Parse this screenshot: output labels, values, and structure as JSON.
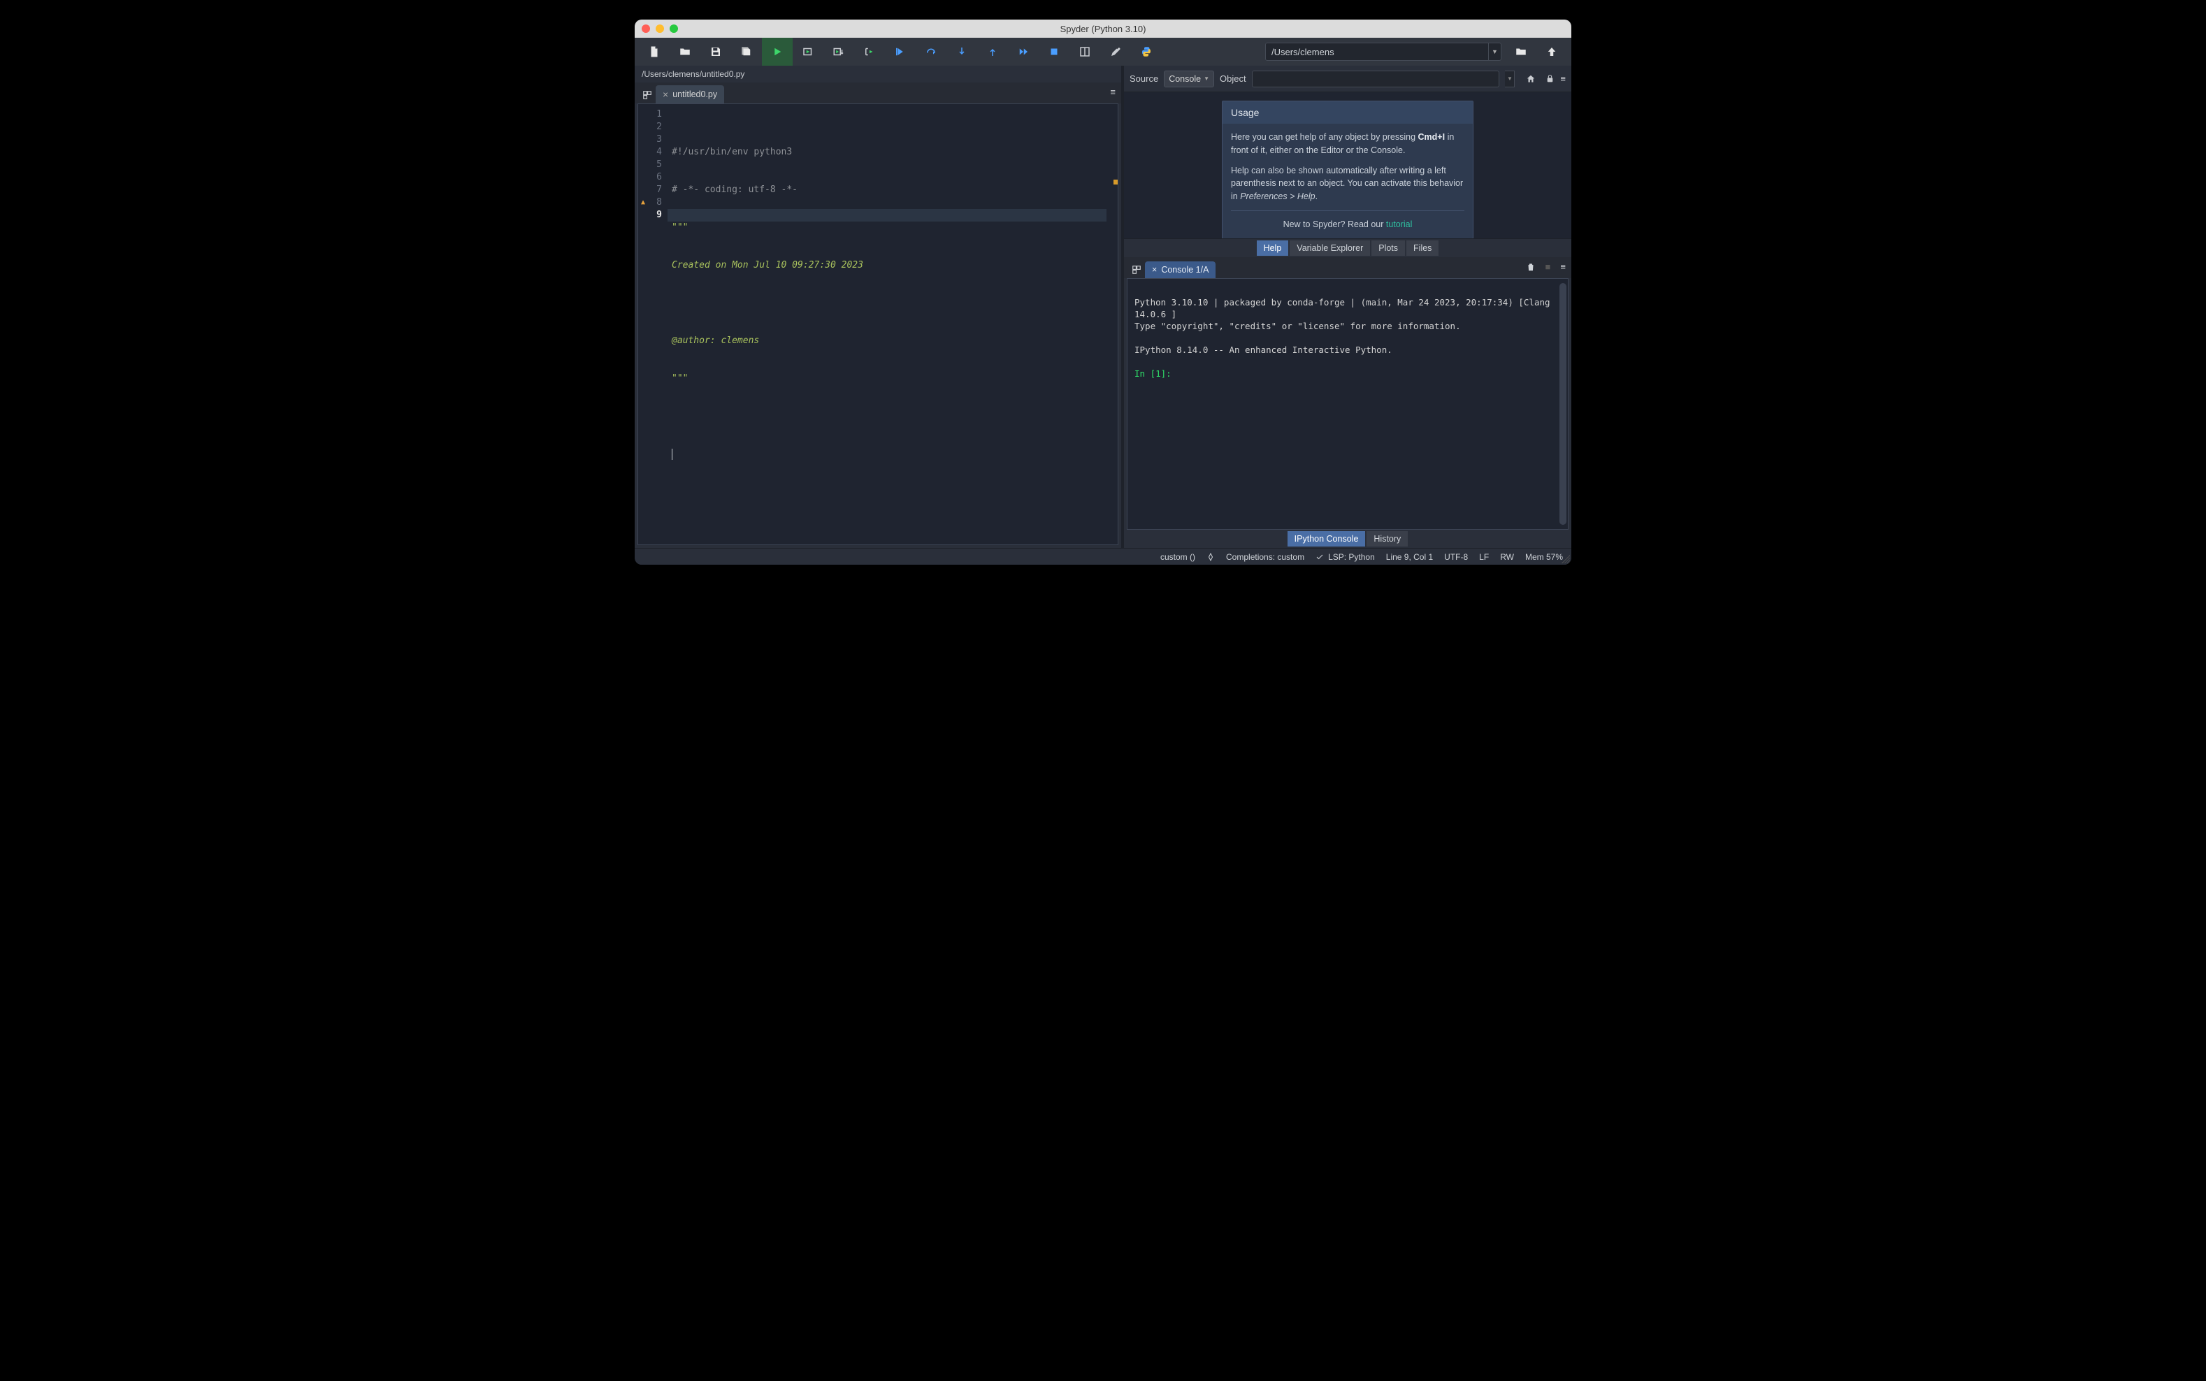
{
  "window": {
    "title": "Spyder (Python 3.10)"
  },
  "toolbar": {
    "cwd": "/Users/clemens"
  },
  "editor": {
    "path": "/Users/clemens/untitled0.py",
    "tab": "untitled0.py",
    "lines": {
      "l1": "#!/usr/bin/env python3",
      "l2": "# -*- coding: utf-8 -*-",
      "l3": "\"\"\"",
      "l4": "Created on Mon Jul 10 09:27:30 2023",
      "l5": "",
      "l6": "@author: clemens",
      "l7": "\"\"\"",
      "l8": "",
      "l9": ""
    },
    "gutter": {
      "n1": "1",
      "n2": "2",
      "n3": "3",
      "n4": "4",
      "n5": "5",
      "n6": "6",
      "n7": "7",
      "n8": "8",
      "n9": "9"
    }
  },
  "help": {
    "source_label": "Source",
    "source_value": "Console",
    "object_label": "Object",
    "card_title": "Usage",
    "p1a": "Here you can get help of any object by pressing ",
    "p1key": "Cmd+I",
    "p1b": " in front of it, either on the Editor or the Console.",
    "p2a": "Help can also be shown automatically after writing a left parenthesis next to an object. You can activate this behavior in ",
    "p2i": "Preferences > Help",
    "p2b": ".",
    "p3a": "New to Spyder? Read our ",
    "p3link": "tutorial"
  },
  "help_tabs": {
    "t1": "Help",
    "t2": "Variable Explorer",
    "t3": "Plots",
    "t4": "Files"
  },
  "console": {
    "tab": "Console 1/A",
    "line1": "Python 3.10.10 | packaged by conda-forge | (main, Mar 24 2023, 20:17:34) [Clang 14.0.6 ]",
    "line2": "Type \"copyright\", \"credits\" or \"license\" for more information.",
    "line3": "",
    "line4": "IPython 8.14.0 -- An enhanced Interactive Python.",
    "line5": "",
    "prompt": "In [1]:"
  },
  "console_tabs": {
    "t1": "IPython Console",
    "t2": "History"
  },
  "status": {
    "interp": "custom ()",
    "completions": "Completions: custom",
    "lsp": "LSP: Python",
    "cursor": "Line 9, Col 1",
    "encoding": "UTF-8",
    "eol": "LF",
    "perm": "RW",
    "mem": "Mem 57%"
  }
}
